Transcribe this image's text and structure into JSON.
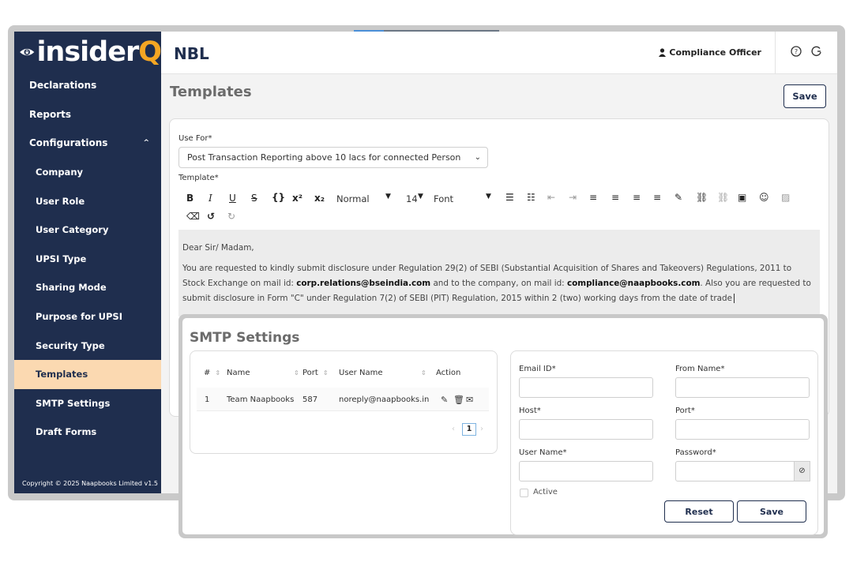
{
  "logo": {
    "text": "insider",
    "accent": "Q"
  },
  "header": {
    "company": "NBL",
    "user": "Compliance Officer",
    "help_icon": "?",
    "logout_icon": "G"
  },
  "sidebar": {
    "items": [
      {
        "label": "Declarations"
      },
      {
        "label": "Reports"
      },
      {
        "label": "Configurations",
        "expanded": true
      },
      {
        "label": "Company"
      },
      {
        "label": "User Role"
      },
      {
        "label": "User Category"
      },
      {
        "label": "UPSI Type"
      },
      {
        "label": "Sharing Mode"
      },
      {
        "label": "Purpose for UPSI"
      },
      {
        "label": "Security Type"
      },
      {
        "label": "Templates",
        "active": true
      },
      {
        "label": "SMTP Settings"
      },
      {
        "label": "Draft Forms"
      }
    ],
    "copyright": "Copyright © 2025  Naapbooks Limited v1.5"
  },
  "page": {
    "title": "Templates",
    "save_label": "Save"
  },
  "form": {
    "use_for_label": "Use For*",
    "use_for_value": "Post Transaction Reporting above 10 lacs for connected Person",
    "template_label": "Template*",
    "toolbar": {
      "heading": "Normal",
      "size": "14",
      "font": "Font"
    },
    "editor": {
      "greeting": "Dear Sir/ Madam,",
      "body_1": "You are requested to kindly submit disclosure under Regulation 29(2) of SEBI (Substantial Acquisition of Shares and Takeovers) Regulations, 2011 to Stock Exchange on mail id: ",
      "email_1": "corp.relations@bseindia.com",
      "body_2": " and to the company, on mail id: ",
      "email_2": "compliance@naapbooks.com",
      "body_3": ". Also you are requested to submit disclosure in Form \"C\" under Regulation 7(2) of SEBI (PIT) Regulation, 2015 within 2 (two) working days from the date of trade"
    }
  },
  "smtp": {
    "title": "SMTP Settings",
    "columns": [
      "#",
      "Name",
      "Port",
      "User Name",
      "Action"
    ],
    "rows": [
      {
        "num": "1",
        "name": "Team Naapbooks",
        "port": "587",
        "user": "noreply@naapbooks.in"
      }
    ],
    "page": "1",
    "labels": {
      "email": "Email ID*",
      "from_name": "From Name*",
      "host": "Host*",
      "port": "Port*",
      "user_name": "User Name*",
      "password": "Password*",
      "active": "Active"
    },
    "reset_label": "Reset",
    "save_label": "Save"
  },
  "colors": {
    "sidebar": "#1f2e4e",
    "active_item": "#fbd9b1",
    "logo_accent": "#f5a623"
  }
}
